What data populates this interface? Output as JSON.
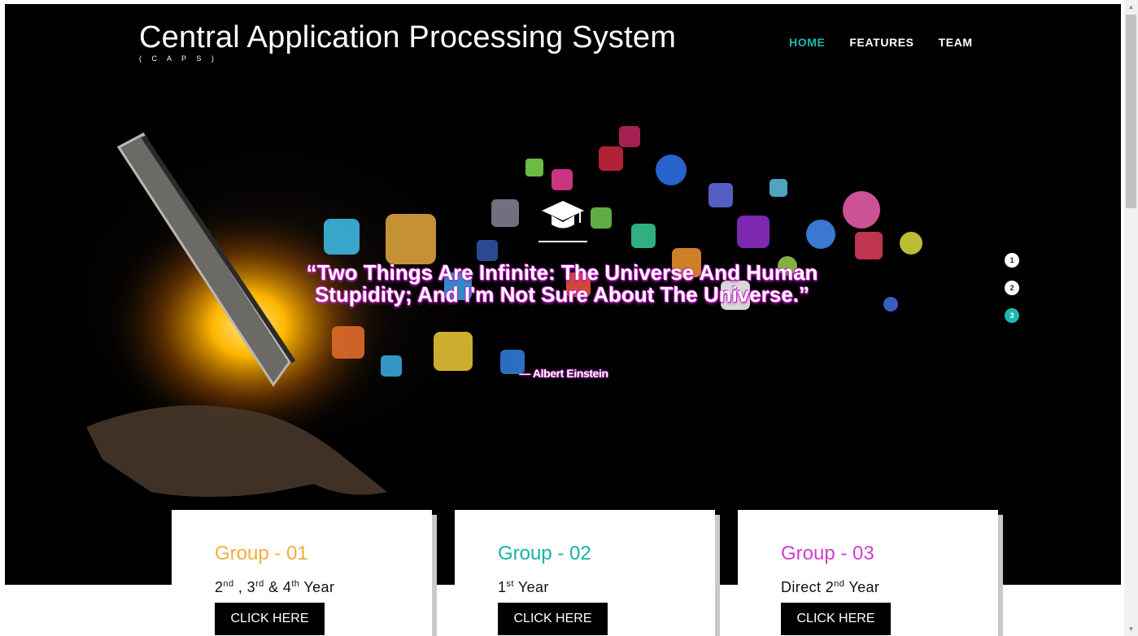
{
  "header": {
    "title": "Central Application Processing System",
    "subtitle": "( C A P S )",
    "nav": [
      {
        "label": "HOME",
        "active": true
      },
      {
        "label": "FEATURES",
        "active": false
      },
      {
        "label": "TEAM",
        "active": false
      }
    ]
  },
  "hero": {
    "icon": "graduation-cap-icon",
    "quote": "“Two Things Are Infinite: The Universe And Human Stupidity; And I'm Not Sure About The Universe.”",
    "author": "— Albert Einstein",
    "slides": [
      "1",
      "2",
      "3"
    ],
    "active_slide": 3
  },
  "cards": [
    {
      "title": "Group - 01",
      "color": "#f2ad3f",
      "year_text": "2nd , 3rd & 4th Year",
      "button": "CLICK HERE"
    },
    {
      "title": "Group - 02",
      "color": "#19b1a8",
      "year_text": "1st Year",
      "button": "CLICK HERE"
    },
    {
      "title": "Group - 03",
      "color": "#d13fce",
      "year_text": "Direct 2nd Year",
      "button": "CLICK HERE"
    }
  ],
  "colors": {
    "accent": "#1bbab0",
    "quote_glow": "#c21bc6"
  }
}
